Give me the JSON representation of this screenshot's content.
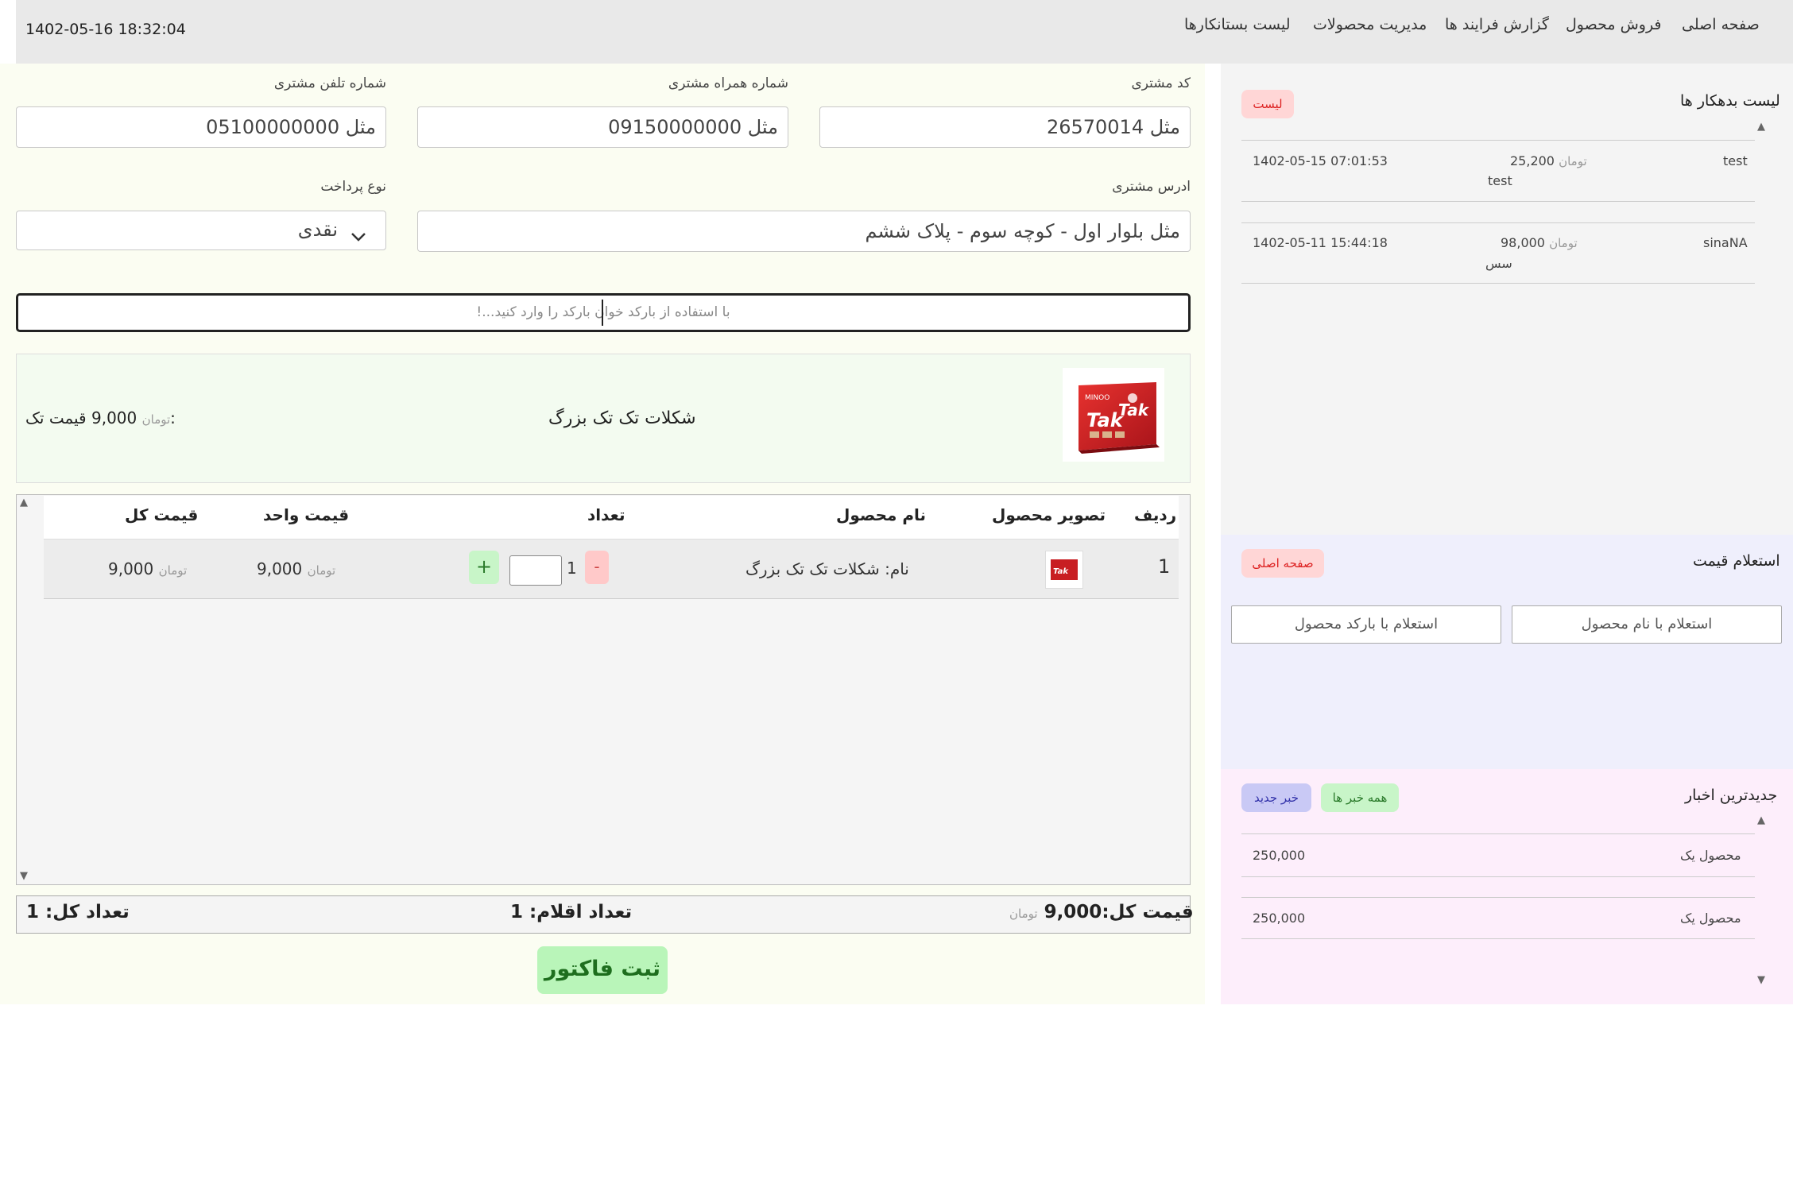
{
  "nav": {
    "items": [
      "صفحه اصلی",
      "فروش محصول",
      "گزارش فرایند ها",
      "مدیریت محصولات",
      "لیست بستانکارها"
    ],
    "datetime": "1402-05-16 18:32:04"
  },
  "form": {
    "customer_code_label": "کد مشتری",
    "customer_code_placeholder": "مثل 26570014",
    "mobile_label": "شماره همراه مشتری",
    "mobile_placeholder": "مثل 09150000000",
    "phone_label": "شماره تلفن مشتری",
    "phone_placeholder": "مثل 05100000000",
    "address_label": "ادرس مشتری",
    "address_placeholder": "مثل بلوار اول - کوچه سوم - پلاک ششم",
    "payment_label": "نوع پرداخت",
    "payment_value": "نقدی",
    "barcode_placeholder": "با استفاده از بارکد خوان بارکد را وارد کنید...!"
  },
  "preview": {
    "product_name": "شکلات تک تک بزرگ",
    "unit_price_label": "قیمت تک:",
    "unit_price": "9,000",
    "currency": "تومان"
  },
  "table": {
    "headers": [
      "ردیف",
      "تصویر محصول",
      "نام محصول",
      "تعداد",
      "قیمت واحد",
      "قیمت کل"
    ],
    "rows": [
      {
        "index": "1",
        "name": "نام: شکلات تک تک بزرگ",
        "qty": "1",
        "minus": "-",
        "plus": "+",
        "unit_price": "9,000",
        "total": "9,000",
        "currency": "تومان"
      }
    ]
  },
  "totals": {
    "total_price_label": "قیمت کل:",
    "total_price": "9,000",
    "currency": "تومان",
    "items_count_label": "تعداد اقلام:",
    "items_count": "1",
    "total_count_label": "تعداد کل:",
    "total_count": "1"
  },
  "submit_label": "ثبت فاکتور",
  "debtors": {
    "title": "لیست بدهکار ها",
    "list_button": "لیست",
    "rows": [
      {
        "name": "test",
        "amount": "25,200",
        "currency": "تومان",
        "note": "test",
        "datetime": "1402-05-15 07:01:53"
      },
      {
        "name": "sinaNA",
        "amount": "98,000",
        "currency": "تومان",
        "note": "سس",
        "datetime": "1402-05-11 15:44:18"
      }
    ]
  },
  "price_inquiry": {
    "title": "استعلام قیمت",
    "home_button": "صفحه اصلی",
    "by_name_button": "استعلام با نام محصول",
    "by_barcode_button": "استعلام با بارکد محصول"
  },
  "news": {
    "title": "جدیدترین اخبار",
    "all_button": "همه خبر ها",
    "new_button": "خبر جدید",
    "items": [
      {
        "title": "محصول یک",
        "value": "250,000"
      },
      {
        "title": "محصول یک",
        "value": "250,000"
      }
    ]
  },
  "colors": {
    "accent_red_bg": "#ffd6d6",
    "accent_green_bg": "#c8f5c8",
    "accent_blue_bg": "#c9c9f5"
  }
}
